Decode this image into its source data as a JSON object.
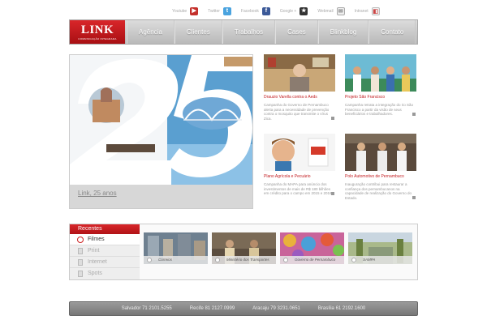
{
  "social": [
    {
      "label": "Youtube",
      "icon": "youtube-icon",
      "color": "#c4302b"
    },
    {
      "label": "Twitter",
      "icon": "twitter-icon",
      "color": "#4aa3df"
    },
    {
      "label": "Facebook",
      "icon": "facebook-icon",
      "color": "#3b5998"
    },
    {
      "label": "Google +",
      "icon": "google-plus-icon",
      "color": "#333333"
    },
    {
      "label": "Webmail",
      "icon": "mail-icon",
      "color": "#999999"
    },
    {
      "label": "Intranet",
      "icon": "intranet-icon",
      "color": "#bbbbbb"
    }
  ],
  "header": {
    "logo": {
      "name": "LINK",
      "tagline": "COMUNICAÇÃO INTEGRADA"
    },
    "nav": [
      "Agência",
      "Clientes",
      "Trabalhos",
      "Cases",
      "Blinkblog",
      "Contato"
    ]
  },
  "hero": {
    "title": "Link, 25 anos",
    "big_number": "25"
  },
  "cards": [
    {
      "title": "Drauzio Varella contra o Aeds",
      "desc": "Campanha do Governo de Pernambuco alerta para a necessidade de prevenção contra o mosquito que transmite o vírus Zica."
    },
    {
      "title": "Projeto São Francisco",
      "desc": "Campanha retrata a integração do rio São Francisco a partir da visão de seus beneficiários e trabalhadores."
    },
    {
      "title": "Plano Agrícola e Pecuário",
      "desc": "Campanha do MAPA para anúncio dos investimentos de mais de R$ 180 bilhões em crédito para o campo em 2015 e 2016."
    },
    {
      "title": "Polo Automotivo de Pernambuco",
      "desc": "Inauguração contribui para restaurar a confiança dos pernambucanos na capacidade de realização do Governo do Estado."
    }
  ],
  "recentes": {
    "header": "Recentes",
    "items": [
      "Filmes",
      "Print",
      "Internet",
      "Spots"
    ],
    "videos": [
      "Correios",
      "Ministério dos Transportes",
      "Governo de Pernambuco",
      "SAMPA"
    ]
  },
  "footer": {
    "offices": [
      "Salvador 71 2101.5255",
      "Recife 81 2127.0999",
      "Aracaju 79 3231.0651",
      "Brasília 61 2192.1600"
    ]
  },
  "colors": {
    "brand_red": "#c21b1f",
    "nav_gray": "#c5c5c5",
    "footer_gray": "#888888"
  }
}
